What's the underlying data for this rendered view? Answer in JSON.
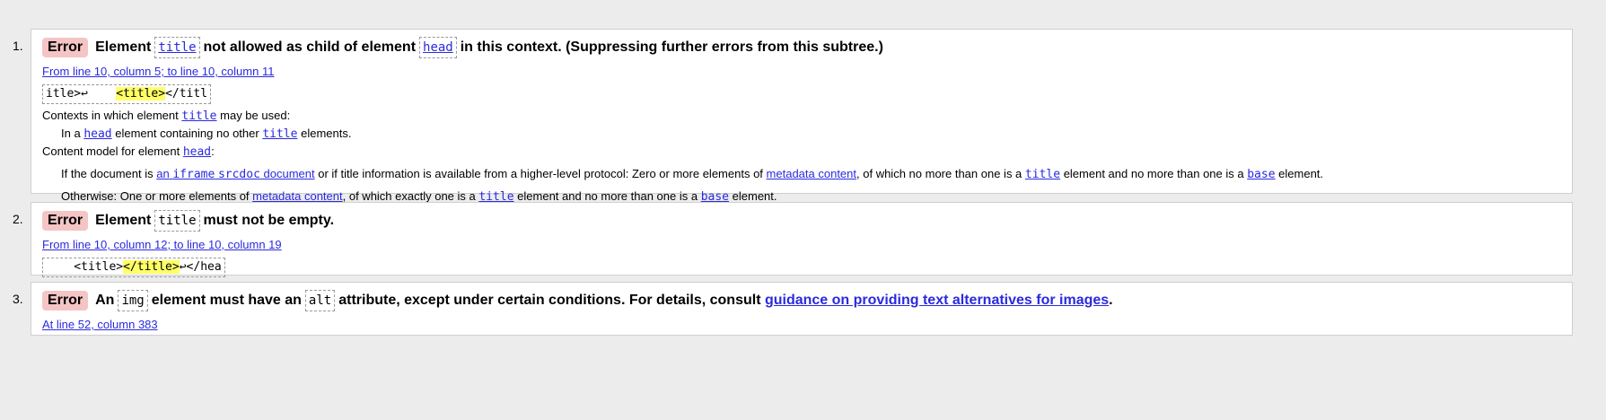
{
  "messages": [
    {
      "number": "1.",
      "type": "Error",
      "headline": {
        "t1": "Element",
        "code1": "title",
        "t2": "not allowed as child of element",
        "code2": "head",
        "t3": "in this context. (Suppressing further errors from this subtree.)"
      },
      "location": "From line 10, column 5; to line 10, column 11",
      "extract": {
        "before": "itle>↩    ",
        "highlight": "<title>",
        "after": "</titl"
      },
      "details": {
        "contexts_label_a": "Contexts in which element",
        "contexts_code": "title",
        "contexts_label_b": "may be used:",
        "context_a": "In a",
        "context_code1": "head",
        "context_b": "element containing no other",
        "context_code2": "title",
        "context_c": "elements.",
        "model_label": "Content model for element",
        "model_code": "head",
        "model1_a": "If the document is",
        "model1_link_a": "an",
        "model1_link_code1": "iframe",
        "model1_link_code2": "srcdoc",
        "model1_link_b": "document",
        "model1_b": "or if title information is available from a higher-level protocol: Zero or more elements of",
        "model1_link2": "metadata content",
        "model1_c": ", of which no more than one is a",
        "model1_code1": "title",
        "model1_d": "element and no more than one is a",
        "model1_code2": "base",
        "model1_e": "element.",
        "model2_a": "Otherwise: One or more elements of",
        "model2_link": "metadata content",
        "model2_b": ", of which exactly one is a",
        "model2_code1": "title",
        "model2_c": "element and no more than one is a",
        "model2_code2": "base",
        "model2_d": "element."
      }
    },
    {
      "number": "2.",
      "type": "Error",
      "headline": {
        "t1": "Element",
        "code1": "title",
        "t2": "must not be empty."
      },
      "location": "From line 10, column 12; to line 10, column 19",
      "extract": {
        "before": "    <title>",
        "highlight": "</title>",
        "after": "↩</hea"
      }
    },
    {
      "number": "3.",
      "type": "Error",
      "headline": {
        "t1": "An",
        "code1": "img",
        "t2": "element must have an",
        "code2": "alt",
        "t3": "attribute, except under certain conditions. For details, consult",
        "link": "guidance on providing text alternatives for images",
        "t4": "."
      },
      "location": "At line 52, column 383"
    }
  ]
}
